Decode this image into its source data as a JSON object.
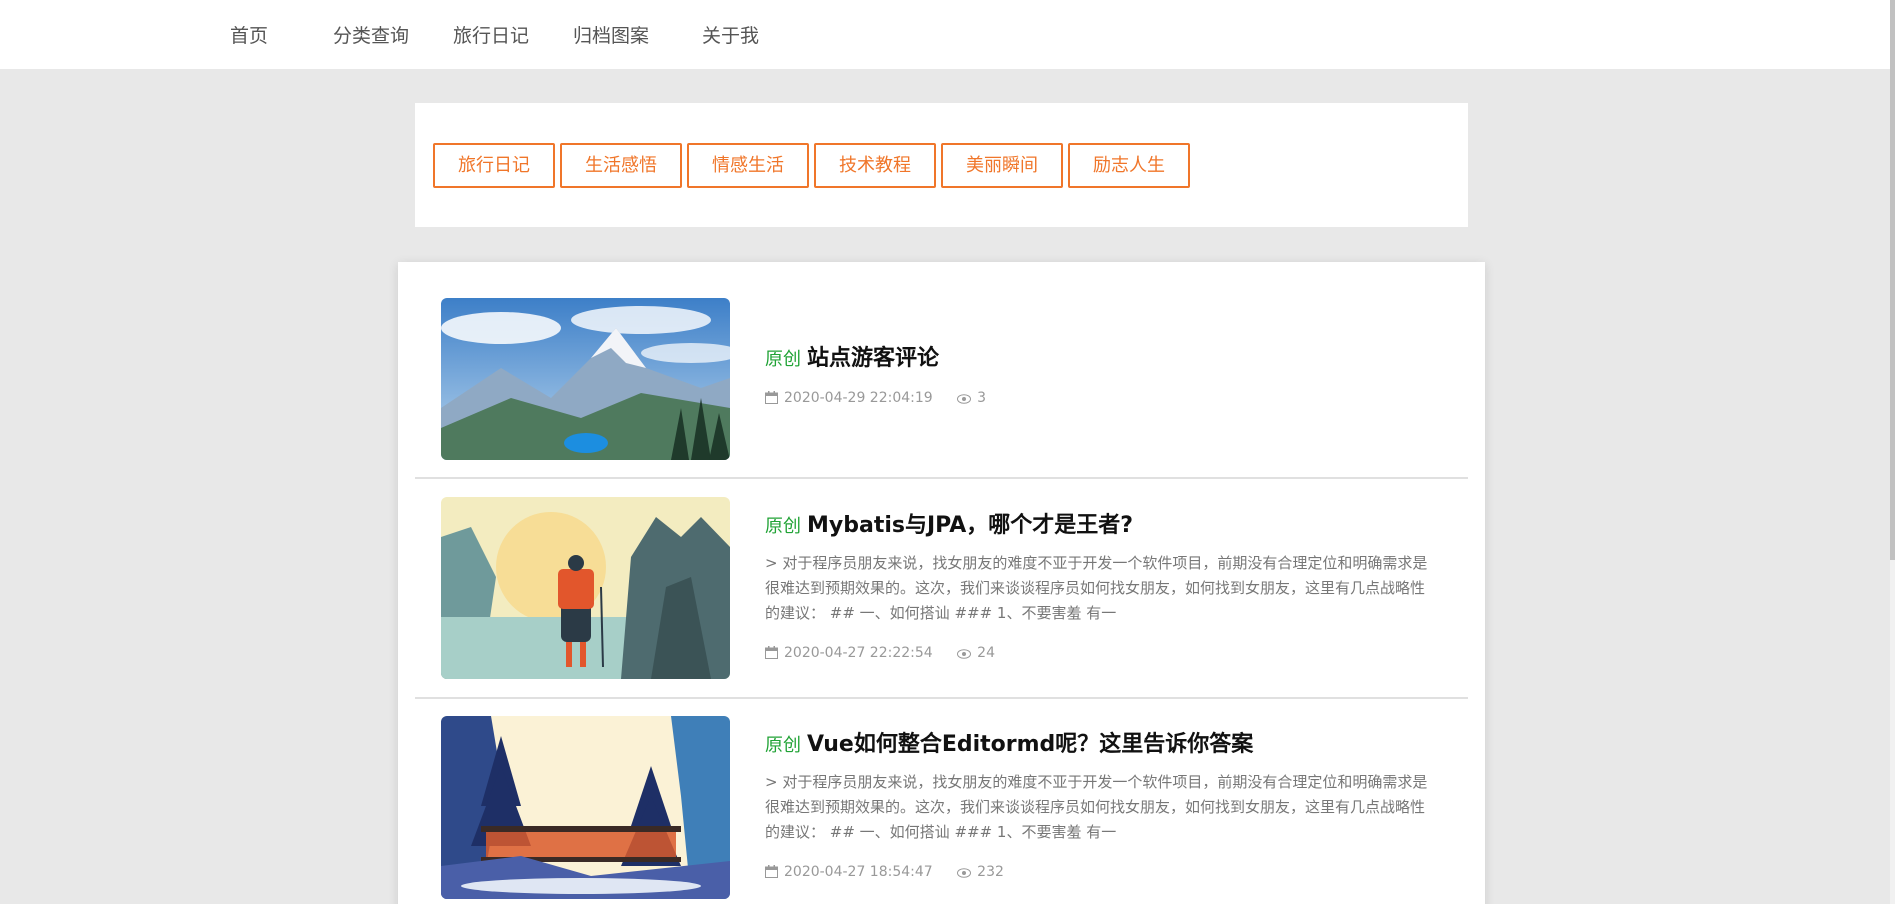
{
  "nav": {
    "items": [
      "首页",
      "分类查询",
      "旅行日记",
      "归档图案",
      "关于我"
    ]
  },
  "categories": [
    "旅行日记",
    "生活感悟",
    "情感生活",
    "技术教程",
    "美丽瞬间",
    "励志人生"
  ],
  "articles": [
    {
      "tag": "原创",
      "title": "站点游客评论",
      "excerpt": "",
      "date": "2020-04-29 22:04:19",
      "views": "3"
    },
    {
      "tag": "原创",
      "title": "Mybatis与JPA，哪个才是王者?",
      "excerpt": "> 对于程序员朋友来说，找女朋友的难度不亚于开发一个软件项目，前期没有合理定位和明确需求是很难达到预期效果的。这次，我们来谈谈程序员如何找女朋友，如何找到女朋友，这里有几点战略性的建议： ## 一、如何搭讪 ### 1、不要害羞 有一",
      "date": "2020-04-27 22:22:54",
      "views": "24"
    },
    {
      "tag": "原创",
      "title": "Vue如何整合Editormd呢？这里告诉你答案",
      "excerpt": "> 对于程序员朋友来说，找女朋友的难度不亚于开发一个软件项目，前期没有合理定位和明确需求是很难达到预期效果的。这次，我们来谈谈程序员如何找女朋友，如何找到女朋友，这里有几点战略性的建议： ## 一、如何搭讪 ### 1、不要害羞 有一",
      "date": "2020-04-27 18:54:47",
      "views": "232"
    }
  ],
  "colors": {
    "accent": "#f0762a",
    "tag": "#21a336",
    "background": "#e8e8e8"
  },
  "icons": {
    "date": "calendar-icon",
    "views": "eye-icon"
  }
}
